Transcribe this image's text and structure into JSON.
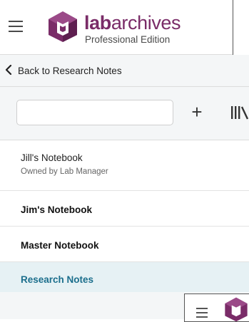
{
  "brand": {
    "name_bold": "lab",
    "name_light": "archives",
    "edition": "Professional Edition",
    "color": "#7a2c68"
  },
  "header": {
    "menu_icon": "hamburger-icon",
    "logo_icon": "labarchives-logo-icon"
  },
  "nav": {
    "back_label": "Back to Research Notes",
    "back_icon": "chevron-left-icon"
  },
  "tools": {
    "search_placeholder": "",
    "search_value": "",
    "add_label": "+",
    "add_icon": "plus-icon",
    "library_icon": "library-icon"
  },
  "notebooks": [
    {
      "name": "Jill's Notebook",
      "owner": "Owned by Lab Manager",
      "active": false
    },
    {
      "name": "Jim's Notebook",
      "owner": "",
      "active": false
    },
    {
      "name": "Master Notebook",
      "owner": "",
      "active": false
    },
    {
      "name": "Research Notes",
      "owner": "",
      "active": true
    }
  ],
  "colors": {
    "active_text": "#1b6e8c",
    "active_bg": "#e6f1f4",
    "panel_bg": "#f4f6f7",
    "divider": "#dcdcdc"
  }
}
